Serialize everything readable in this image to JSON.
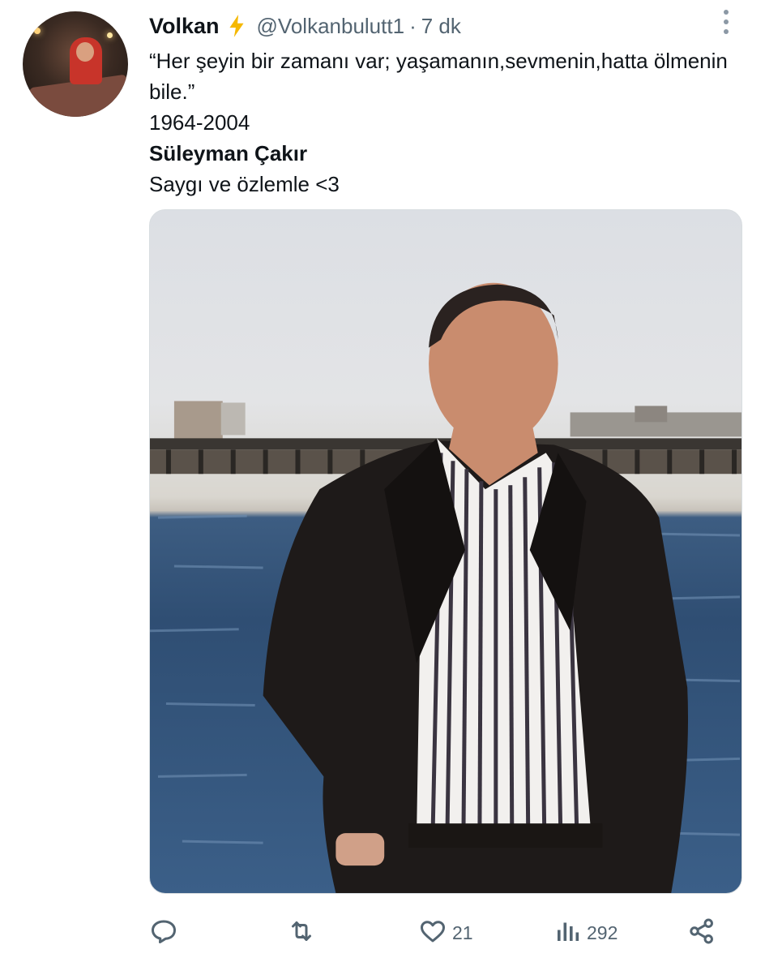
{
  "author": {
    "name": "Volkan",
    "handle": "@Volkanbulutt1",
    "separator": "·",
    "time": "7 dk",
    "badge_icon": "lightning-icon",
    "badge_color": "#f5b800"
  },
  "tweet": {
    "line1": "“Her şeyin bir zamanı var; yaşamanın,sevmenin,hatta ölmenin bile.”",
    "line2": "1964-2004",
    "line3": "Süleyman Çakır",
    "line4": "Saygı ve özlemle <3"
  },
  "actions": {
    "reply_icon": "reply-icon",
    "retweet_icon": "retweet-icon",
    "like_icon": "heart-icon",
    "like_count": "21",
    "views_icon": "views-icon",
    "views_count": "292",
    "share_icon": "share-icon"
  },
  "colors": {
    "secondary_text": "#536471",
    "primary_text": "#0f1419"
  }
}
